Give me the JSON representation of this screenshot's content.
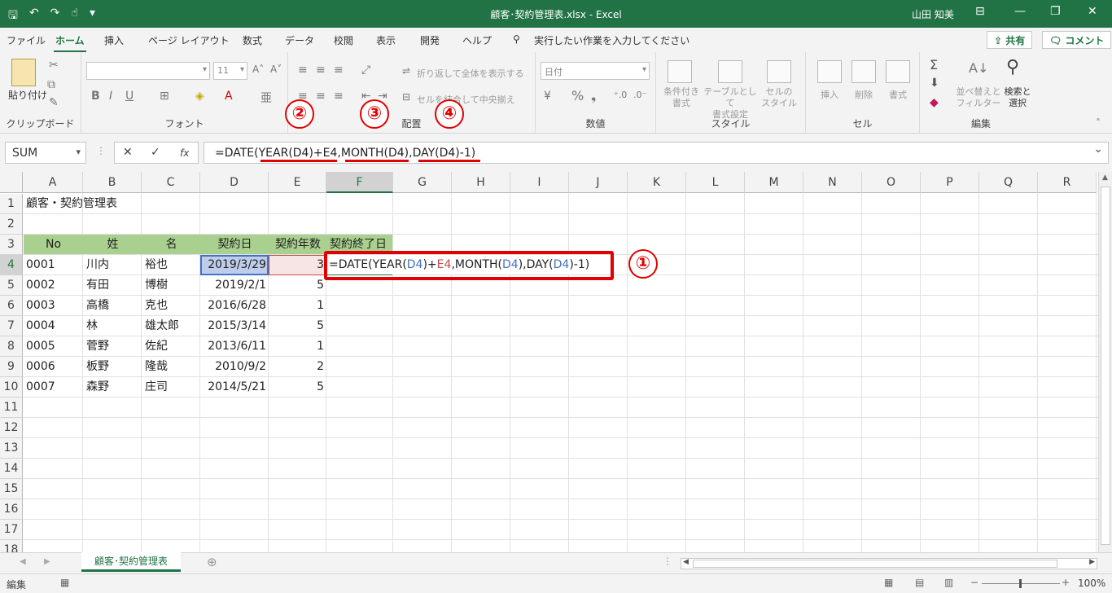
{
  "titlebar": {
    "title": "顧客･契約管理表.xlsx - Excel",
    "user": "山田 知美",
    "qat": [
      "save-icon",
      "undo-icon",
      "redo-icon",
      "touch-mode-icon",
      "customize-icon"
    ]
  },
  "tabs": [
    "ファイル",
    "ホーム",
    "挿入",
    "ページ レイアウト",
    "数式",
    "データ",
    "校閲",
    "表示",
    "開発",
    "ヘルプ"
  ],
  "active_tab": "ホーム",
  "tell_me": "実行したい作業を入力してください",
  "share": "共有",
  "comment": "コメント",
  "ribbon": {
    "clipboard": {
      "paste": "貼り付け",
      "label": "クリップボード"
    },
    "font": {
      "font_name": "",
      "font_size": "11",
      "label": "フォント"
    },
    "alignment": {
      "wrap": "折り返して全体を表示する",
      "merge": "セルを結合して中央揃え",
      "label": "配置"
    },
    "number": {
      "format": "日付",
      "label": "数値"
    },
    "styles": {
      "conditional": "条件付き\n書式",
      "table": "テーブルとして\n書式設定",
      "cell_styles": "セルの\nスタイル",
      "label": "スタイル"
    },
    "cells": {
      "insert": "挿入",
      "delete": "削除",
      "format": "書式",
      "label": "セル"
    },
    "editing": {
      "sort": "並べ替えと\nフィルター",
      "find": "検索と\n選択",
      "label": "編集"
    }
  },
  "formula_bar": {
    "name_box": "SUM",
    "formula": "=DATE(YEAR(D4)+E4,MONTH(D4),DAY(D4)-1)",
    "fx": "fx"
  },
  "columns": [
    "A",
    "B",
    "C",
    "D",
    "E",
    "F",
    "G",
    "H",
    "I",
    "J",
    "K",
    "L",
    "M",
    "N",
    "O",
    "P",
    "Q",
    "R"
  ],
  "rows": [
    "1",
    "2",
    "3",
    "4",
    "5",
    "6",
    "7",
    "8",
    "9",
    "10",
    "11",
    "12",
    "13",
    "14",
    "15",
    "16",
    "17",
    "18"
  ],
  "title_cell": "顧客・契約管理表",
  "table_header": [
    "No",
    "姓",
    "名",
    "契約日",
    "契約年数",
    "契約終了日"
  ],
  "table_rows": [
    [
      "0001",
      "川内",
      "裕也",
      "2019/3/29",
      "3"
    ],
    [
      "0002",
      "有田",
      "博樹",
      "2019/2/1",
      "5"
    ],
    [
      "0003",
      "高橋",
      "克也",
      "2016/6/28",
      "1"
    ],
    [
      "0004",
      "林",
      "雄太郎",
      "2015/3/14",
      "5"
    ],
    [
      "0005",
      "菅野",
      "佐紀",
      "2013/6/11",
      "1"
    ],
    [
      "0006",
      "板野",
      "隆哉",
      "2010/9/2",
      "2"
    ],
    [
      "0007",
      "森野",
      "庄司",
      "2014/5/21",
      "5"
    ]
  ],
  "edit_cell": {
    "parts": [
      "=DATE(YEAR(",
      "D4",
      ")+",
      "E4",
      ",MONTH(",
      "D4",
      "),DAY(",
      "D4",
      ")-1)"
    ]
  },
  "annotations": [
    "①",
    "②",
    "③",
    "④"
  ],
  "sheet_tab": "顧客･契約管理表",
  "status": {
    "mode": "編集",
    "zoom": "100%"
  },
  "colors": {
    "excel_green": "#217346",
    "header_fill": "#a9d08e",
    "callout_red": "#e00000",
    "ref_blue": "#4472c4",
    "ref_red": "#c0504d"
  }
}
